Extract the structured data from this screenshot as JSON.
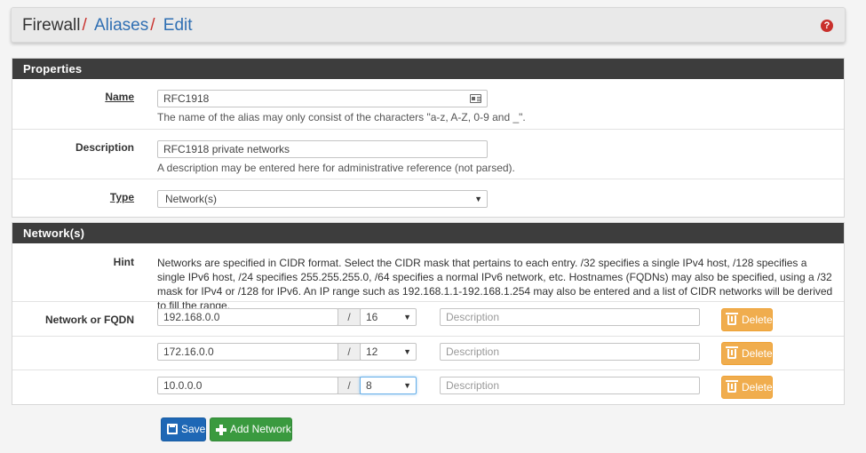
{
  "breadcrumb": {
    "items": [
      "Firewall",
      "Aliases",
      "Edit"
    ],
    "separator": "/"
  },
  "help_icon": "?",
  "properties": {
    "heading": "Properties",
    "name": {
      "label": "Name",
      "value": "RFC1918",
      "help": "The name of the alias may only consist of the characters \"a-z, A-Z, 0-9 and _\"."
    },
    "description": {
      "label": "Description",
      "value": "RFC1918 private networks",
      "help": "A description may be entered here for administrative reference (not parsed)."
    },
    "type": {
      "label": "Type",
      "value": "Network(s)"
    }
  },
  "networks": {
    "heading": "Network(s)",
    "hint_label": "Hint",
    "hint_text": "Networks are specified in CIDR format. Select the CIDR mask that pertains to each entry. /32 specifies a single IPv4 host, /128 specifies a single IPv6 host, /24 specifies 255.255.255.0, /64 specifies a normal IPv6 network, etc. Hostnames (FQDNs) may also be specified, using a /32 mask for IPv4 or /128 for IPv6. An IP range such as 192.168.1.1-192.168.1.254 may also be entered and a list of CIDR networks will be derived to fill the range.",
    "row_label": "Network or FQDN",
    "slash": "/",
    "description_placeholder": "Description",
    "delete_label": "Delete",
    "rows": [
      {
        "address": "192.168.0.0",
        "mask": "16"
      },
      {
        "address": "172.16.0.0",
        "mask": "12"
      },
      {
        "address": "10.0.0.0",
        "mask": "8"
      }
    ]
  },
  "buttons": {
    "save": "Save",
    "add_network": "Add Network"
  },
  "colors": {
    "panel_heading": "#3d3d3d",
    "link": "#2f6fb3",
    "separator": "#c9302c",
    "save_button": "#1e67b5",
    "add_button": "#3a9a3f",
    "delete_button": "#f0ad4e"
  },
  "icons": {
    "help": "question-circle-icon",
    "name_field": "address-card-icon",
    "delete": "trash-icon",
    "save": "save-icon",
    "add": "plus-icon",
    "select": "caret-down-icon"
  }
}
